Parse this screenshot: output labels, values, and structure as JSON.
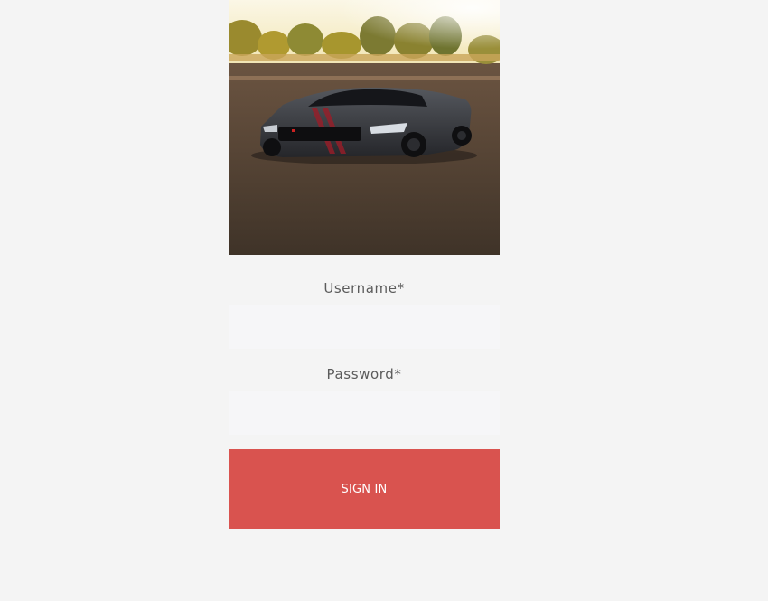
{
  "hero": {
    "image_name": "sports-car-photo"
  },
  "form": {
    "username_label": "Username*",
    "username_value": "",
    "username_placeholder": "",
    "password_label": "Password*",
    "password_value": "",
    "password_placeholder": "",
    "submit_label": "SIGN IN"
  },
  "colors": {
    "background": "#f4f4f4",
    "field_background": "#f6f6f8",
    "button": "#d9534f",
    "button_text": "#ffffff",
    "label_text": "#5b5b5b"
  }
}
